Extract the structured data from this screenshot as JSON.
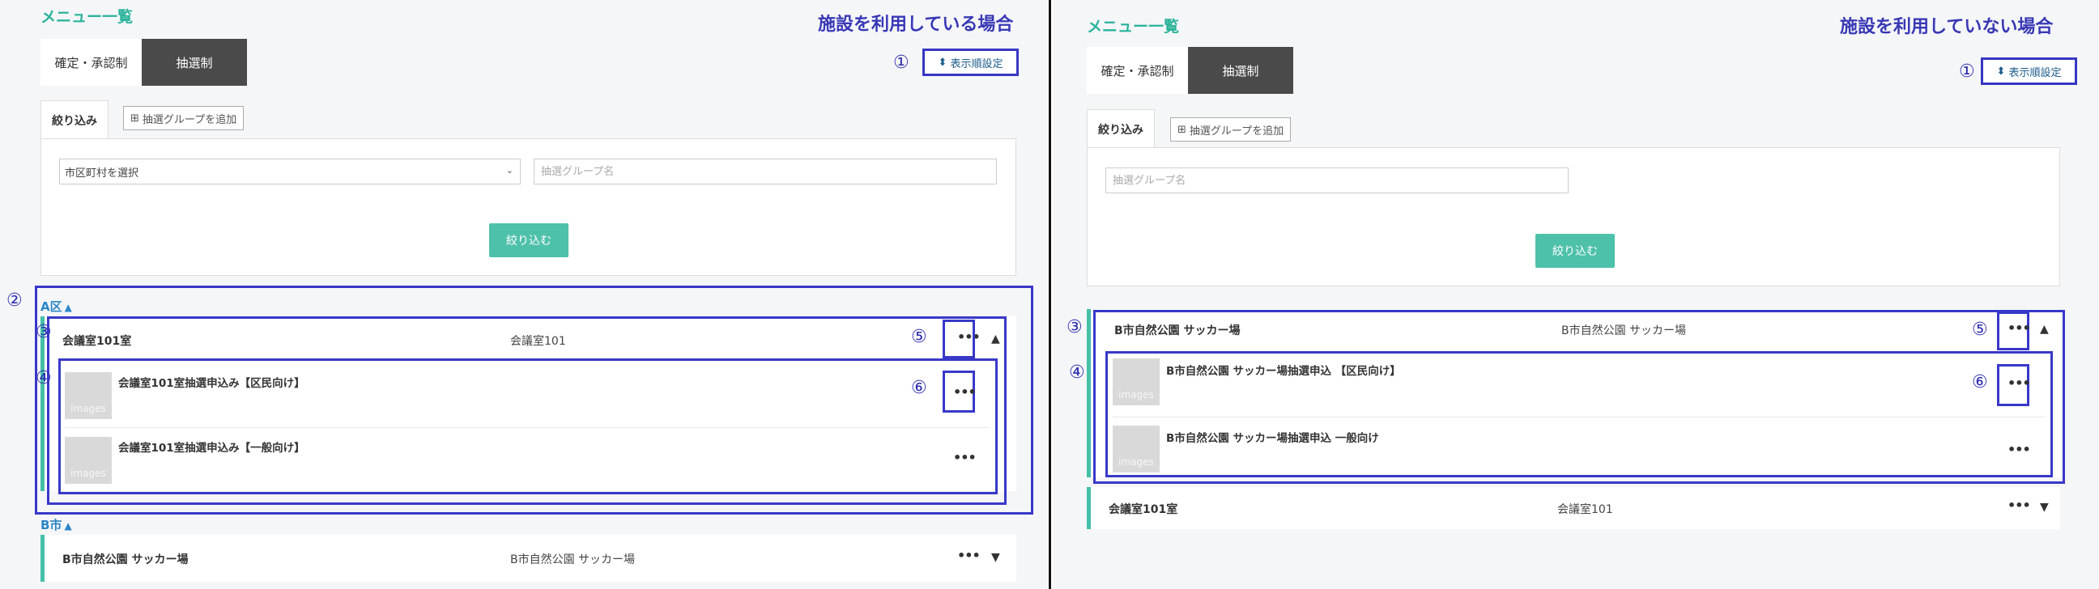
{
  "left": {
    "heading": "メニュー一覧",
    "scene_label": "施設を利用している場合",
    "tabs": {
      "confirm": "確定・承認制",
      "lottery": "抽選制"
    },
    "order_button": "表示順設定",
    "filter_tab": "絞り込み",
    "add_group": "抽選グループを追加",
    "select_city": "市区町村を選択",
    "group_name_placeholder": "抽選グループ名",
    "filter_button": "絞り込む",
    "groups": [
      {
        "label": "A区"
      },
      {
        "label": "B市"
      }
    ],
    "items": [
      {
        "name": "会議室101室",
        "facility": "会議室101"
      },
      {
        "name": "B市自然公園 サッカー場",
        "facility": "B市自然公園 サッカー場"
      }
    ],
    "sub_items": [
      {
        "thumb": "images",
        "title": "会議室101室抽選申込み【区民向け】"
      },
      {
        "thumb": "images",
        "title": "会議室101室抽選申込み【一般向け】"
      }
    ],
    "markers": {
      "m1": "①",
      "m2": "②",
      "m3": "③",
      "m4": "④",
      "m5": "⑤",
      "m6": "⑥"
    }
  },
  "right": {
    "heading": "メニュー一覧",
    "scene_label": "施設を利用していない場合",
    "tabs": {
      "confirm": "確定・承認制",
      "lottery": "抽選制"
    },
    "order_button": "表示順設定",
    "filter_tab": "絞り込み",
    "add_group": "抽選グループを追加",
    "group_name_placeholder": "抽選グループ名",
    "filter_button": "絞り込む",
    "items": [
      {
        "name": "B市自然公園 サッカー場",
        "facility": "B市自然公園 サッカー場"
      },
      {
        "name": "会議室101室",
        "facility": "会議室101"
      }
    ],
    "sub_items": [
      {
        "thumb": "images",
        "title": "B市自然公園 サッカー場抽選申込 【区民向け】"
      },
      {
        "thumb": "images",
        "title": "B市自然公園 サッカー場抽選申込 一般向け"
      }
    ],
    "markers": {
      "m1": "①",
      "m3": "③",
      "m4": "④",
      "m5": "⑤",
      "m6": "⑥"
    }
  },
  "icons": {
    "sort": "sort-icon",
    "add": "plus-box-icon",
    "more": "more-dots-icon",
    "expand": "caret-up-icon",
    "collapse": "caret-down-icon"
  },
  "colors": {
    "accent_green": "#2bb39b",
    "filter_button": "#4ec1aa",
    "annotation_blue": "#3838c9",
    "group_label_blue": "#2a86c7",
    "tab_dark": "#4a4a4a"
  }
}
